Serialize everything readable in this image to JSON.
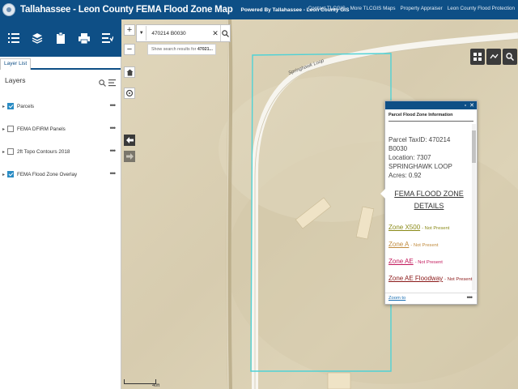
{
  "header": {
    "title": "Tallahassee - Leon County FEMA Flood Zone Map",
    "subtitle": "Powered By Tallahassee - Leon County GIS",
    "links": [
      "Contact TLCGIS",
      "More TLCGIS Maps",
      "Property Appraiser",
      "Leon County Flood Protection"
    ]
  },
  "panel": {
    "tab": "Layer List",
    "heading": "Layers",
    "layers": [
      {
        "name": "Parcels",
        "checked": true
      },
      {
        "name": "FEMA DFIRM Panels",
        "checked": false
      },
      {
        "name": "2ft Topo Contours 2018",
        "checked": false
      },
      {
        "name": "FEMA Flood Zone Overlay",
        "checked": true
      }
    ]
  },
  "search": {
    "value": "470214 B0030",
    "suggestion_prefix": "Show search results for ",
    "suggestion_term": "47021..."
  },
  "map": {
    "street_label": "Springhawk Loop",
    "scale_label": "40ft"
  },
  "popup": {
    "title": "Parcel Flood Zone Information",
    "taxid_label": "Parcel TaxID: ",
    "taxid": "470214 B0030",
    "location_label": "Location: ",
    "location": "7307 SPRINGHAWK LOOP",
    "acres_label": "Acres: ",
    "acres": "0.92",
    "section_title": "FEMA FLOOD ZONE DETAILS",
    "zones": [
      {
        "name": "Zone X500",
        "status": "- Not Present",
        "color": "#8a8a18"
      },
      {
        "name": "Zone A",
        "status": "- Not Present",
        "color": "#c08a3c"
      },
      {
        "name": "Zone AE",
        "status": "- Not Present",
        "color": "#c2185b"
      },
      {
        "name": "Zone AE Floodway",
        "status": "- Not Present",
        "color": "#8b1a1a"
      }
    ],
    "zoom_to": "Zoom to"
  },
  "colors": {
    "header_bg": "#0e4f86",
    "parcel_outline": "#4fd2d6"
  }
}
